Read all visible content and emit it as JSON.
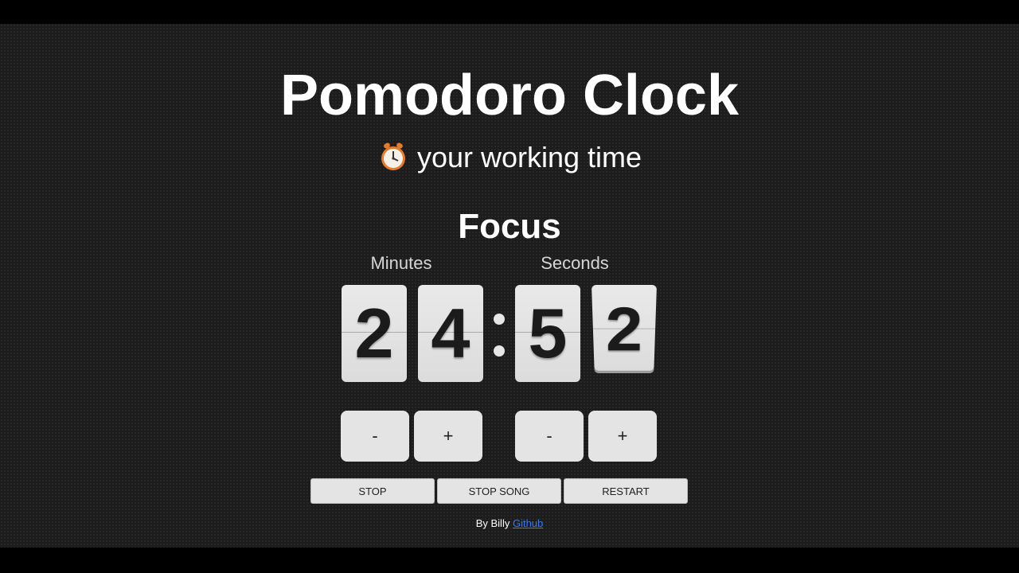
{
  "header": {
    "title": "Pomodoro Clock",
    "subtitle": "your working time",
    "subtitle_icon": "alarm-clock-icon"
  },
  "timer": {
    "mode": "Focus",
    "minutes_label": "Minutes",
    "seconds_label": "Seconds",
    "digits": [
      "2",
      "4",
      "5",
      "2"
    ],
    "separator": ":"
  },
  "steppers": {
    "minutes_decrease": "-",
    "minutes_increase": "+",
    "seconds_decrease": "-",
    "seconds_increase": "+"
  },
  "actions": {
    "stop": "STOP",
    "stop_song": "STOP SONG",
    "restart": "RESTART"
  },
  "footer": {
    "byline": "By Billy",
    "link_text": "Github"
  },
  "colors": {
    "background": "#1c1c1c",
    "text": "#ffffff",
    "card": "#e4e4e4",
    "link": "#2f7bff"
  }
}
